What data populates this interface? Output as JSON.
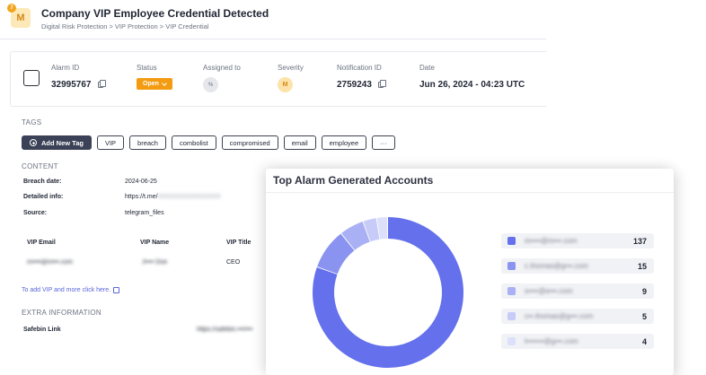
{
  "header": {
    "badge_letter": "M",
    "badge_count": "7",
    "title": "Company VIP Employee Credential Detected",
    "breadcrumb": "Digital Risk Protection > VIP Protection > VIP Credential"
  },
  "alarm": {
    "alarm_id_label": "Alarm ID",
    "alarm_id": "32995767",
    "status_label": "Status",
    "status": "Open",
    "assigned_label": "Assigned to",
    "assigned": "%",
    "severity_label": "Severity",
    "severity": "M",
    "notification_label": "Notification ID",
    "notification_id": "2759243",
    "date_label": "Date",
    "date": "Jun 26, 2024 - 04:23 UTC"
  },
  "tags": {
    "section_label": "TAGS",
    "add_label": "Add New Tag",
    "items": [
      "VIP",
      "breach",
      "combolist",
      "compromised",
      "email",
      "employee",
      "···"
    ]
  },
  "content": {
    "section_label": "CONTENT",
    "breach_date_label": "Breach date:",
    "breach_date": "2024-06-25",
    "detailed_label": "Detailed info:",
    "detailed_value": "https://t.me/",
    "detailed_blur": "XXXXXXXXXXXXXXX",
    "source_label": "Source:",
    "source": "telegram_files",
    "vip_email_label": "VIP Email",
    "vip_name_label": "VIP Name",
    "vip_title_label": "VIP Title",
    "vip_email": "m••••@m•••.com",
    "vip_name": "J•••• Doe",
    "vip_title": "CEO",
    "add_vip_link": "To add VIP and more click here."
  },
  "extra": {
    "section_label": "EXTRA INFORMATION",
    "safebin_label": "Safebin Link",
    "safebin_value": "https://safebin.•••/•••"
  },
  "chart_data": {
    "type": "pie",
    "title": "Top Alarm Generated Accounts",
    "categories": [
      "m••••@m•••.com",
      "c.thomas@g•••.com",
      "s••••@e•••.com",
      "c••.thomas@g•••.com",
      "l•••••••@g•••.com"
    ],
    "values": [
      137,
      15,
      9,
      5,
      4
    ],
    "colors": [
      "#6470ec",
      "#8a94f0",
      "#a9b0f4",
      "#c6cbf8",
      "#dde0fb"
    ]
  }
}
